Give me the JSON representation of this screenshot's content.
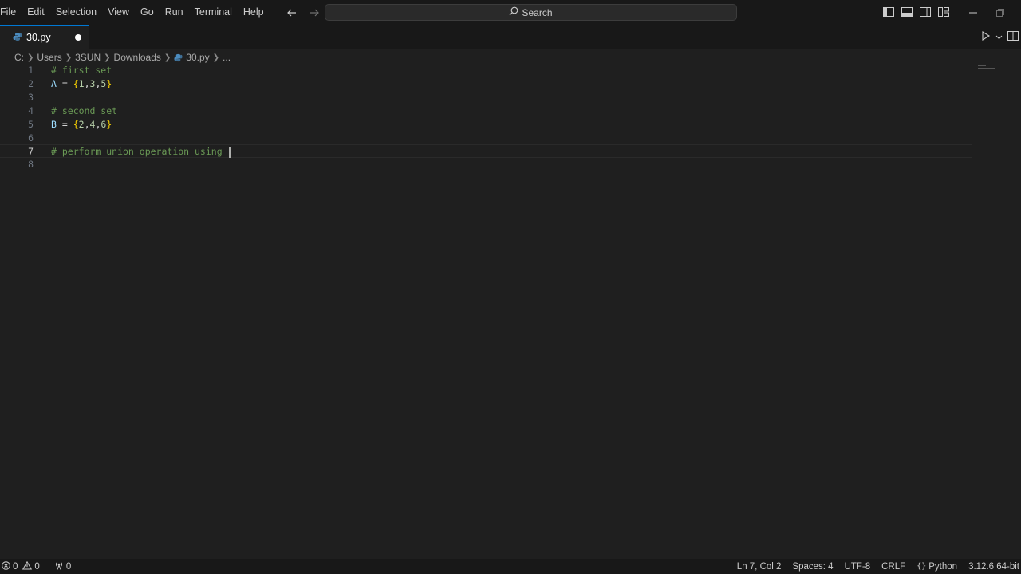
{
  "menu": [
    "File",
    "Edit",
    "Selection",
    "View",
    "Go",
    "Run",
    "Terminal",
    "Help"
  ],
  "search": {
    "label": "Search"
  },
  "tab": {
    "filename": "30.py"
  },
  "breadcrumb": [
    "C:",
    "Users",
    "3SUN",
    "Downloads",
    "30.py",
    "..."
  ],
  "editor": {
    "lines": [
      {
        "num": "1",
        "text": "# first set"
      },
      {
        "num": "2",
        "text": "A = {1,3,5}"
      },
      {
        "num": "3",
        "text": ""
      },
      {
        "num": "4",
        "text": "# second set"
      },
      {
        "num": "5",
        "text": "B = {2,4,6}"
      },
      {
        "num": "6",
        "text": ""
      },
      {
        "num": "7",
        "text": "# perform union operation using "
      },
      {
        "num": "8",
        "text": ""
      }
    ],
    "current_line": 7
  },
  "status": {
    "errors": "0",
    "warnings": "0",
    "ports": "0",
    "position": "Ln 7, Col 2",
    "spaces": "Spaces: 4",
    "encoding": "UTF-8",
    "eol": "CRLF",
    "language": "Python",
    "interpreter": "3.12.6 64-bit"
  },
  "colors": {
    "background": "#1f1f1f",
    "titlebar": "#181818",
    "comment": "#6a9955",
    "variable": "#9cdcfe",
    "brace": "#ffd700",
    "number": "#b5cea8",
    "accent": "#0078d4"
  }
}
